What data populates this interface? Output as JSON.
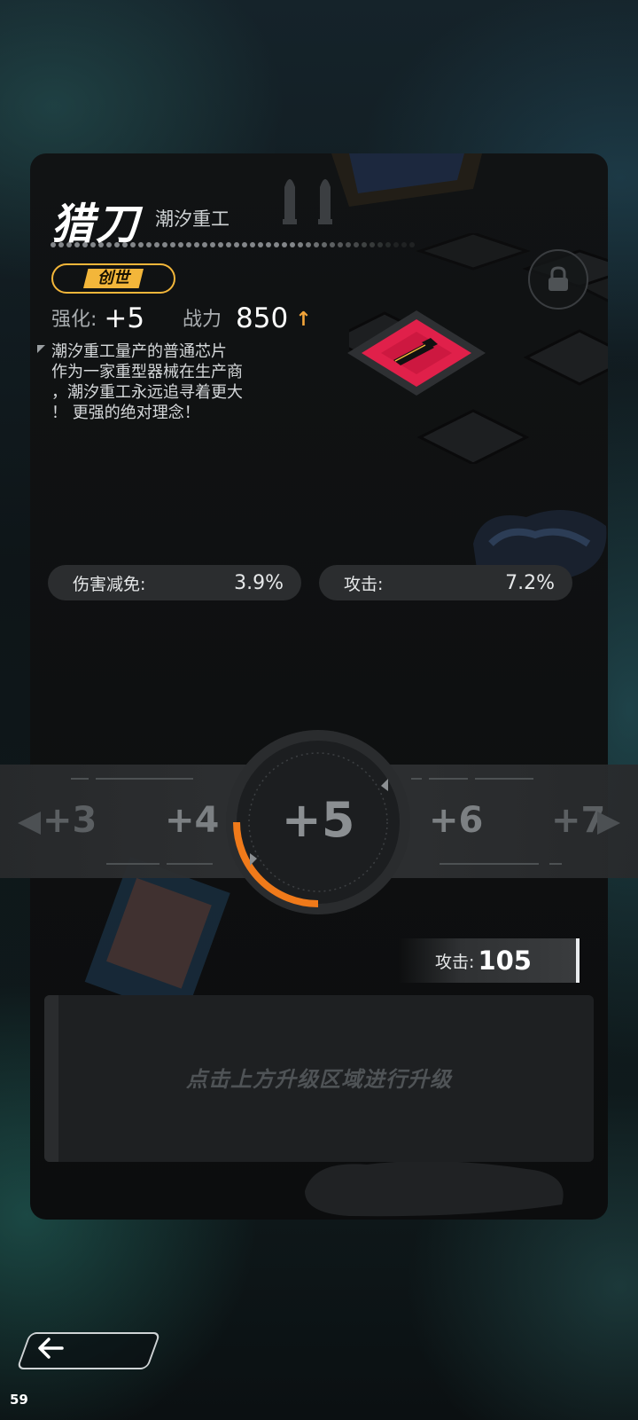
{
  "weapon": {
    "name": "猎刀",
    "maker": "潮汐重工",
    "rarity": "创世",
    "enhance_label": "强化:",
    "enhance_value": "+5",
    "power_label": "战力",
    "power_value": "850",
    "description": [
      "潮汐重工量产的普通芯片",
      "作为一家重型器械在生产商",
      "，潮汐重工永远追寻着更大",
      "！ 更强的绝对理念！"
    ]
  },
  "stats": [
    {
      "label": "伤害减免:",
      "value": "3.9%"
    },
    {
      "label": "攻击:",
      "value": "7.2%"
    }
  ],
  "level_selector": {
    "levels": [
      "+3",
      "+4",
      "+5",
      "+6",
      "+7"
    ],
    "current": "+5",
    "progress": 0.25
  },
  "attack_bonus": {
    "label": "攻击:",
    "value": "105"
  },
  "upgrade_hint": "点击上方升级区域进行升级",
  "fps": "59",
  "colors": {
    "rarity": "#f3b63a",
    "progress": "#f07a1a",
    "chip": "#e0204a"
  }
}
